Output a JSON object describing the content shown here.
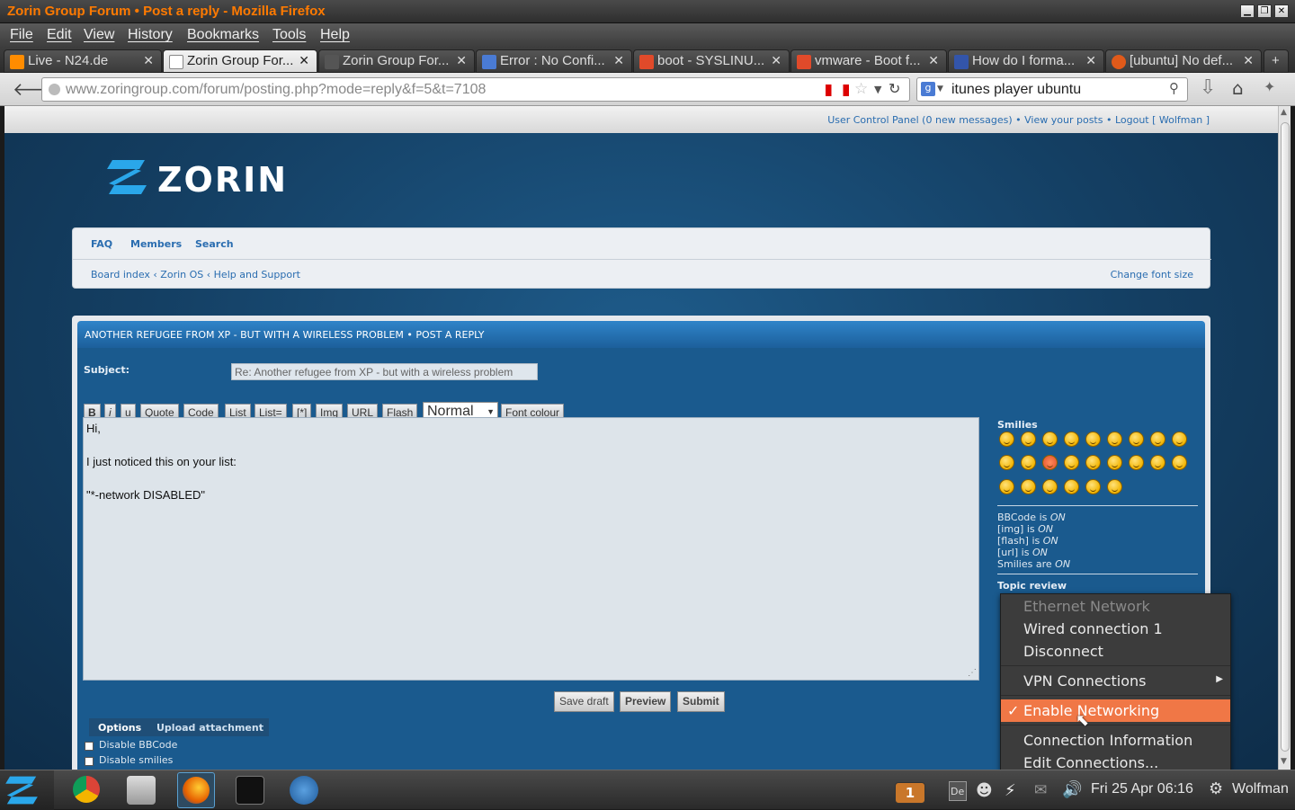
{
  "window": {
    "title": "Zorin Group Forum • Post a reply - Mozilla Firefox"
  },
  "menu": [
    "File",
    "Edit",
    "View",
    "History",
    "Bookmarks",
    "Tools",
    "Help"
  ],
  "tabs": [
    {
      "label": "Live - N24.de",
      "color": "#ff8c00"
    },
    {
      "label": "Zorin Group For...",
      "color": "#ffffff",
      "active": true
    },
    {
      "label": "Zorin Group For...",
      "color": "#555555"
    },
    {
      "label": "Error : No Confi...",
      "color": "#4a7bd4"
    },
    {
      "label": "boot - SYSLINU...",
      "color": "#e04a2a"
    },
    {
      "label": "vmware - Boot f...",
      "color": "#e04a2a"
    },
    {
      "label": "How do I forma...",
      "color": "#3355aa"
    },
    {
      "label": "[ubuntu] No def...",
      "color": "#e05a1a"
    }
  ],
  "nav": {
    "url": "www.zoringroup.com/forum/posting.php?mode=reply&f=5&t=7108",
    "search": "itunes player ubuntu"
  },
  "forum": {
    "userbar": "User Control Panel (0 new messages) • View your posts • Logout [ Wolfman ]",
    "logo": "ZORIN",
    "links": {
      "faq": "FAQ",
      "members": "Members",
      "search": "Search"
    },
    "breadcrumb": "Board index ‹ Zorin OS ‹ Help and Support",
    "change_font": "Change font size",
    "post_title": "ANOTHER REFUGEE FROM XP - BUT WITH A WIRELESS PROBLEM • POST A REPLY",
    "subject_label": "Subject:",
    "subject_value": "Re: Another refugee from XP - but with a wireless problem",
    "bbcode": [
      "B",
      "i",
      "u",
      "Quote",
      "Code",
      "List",
      "List=",
      "[*]",
      "Img",
      "URL",
      "Flash"
    ],
    "font_size": "Normal",
    "font_colour": "Font colour",
    "message": [
      "Hi,",
      "I just noticed this on your list:",
      "\"*-network DISABLED\""
    ],
    "smilies_label": "Smilies",
    "status": [
      {
        "name": "BBCode",
        "verb": "is",
        "val": "ON"
      },
      {
        "name": "[img]",
        "verb": "is",
        "val": "ON"
      },
      {
        "name": "[flash]",
        "verb": "is",
        "val": "ON"
      },
      {
        "name": "[url]",
        "verb": "is",
        "val": "ON"
      },
      {
        "name": "Smilies",
        "verb": "are",
        "val": "ON"
      }
    ],
    "topic_review": "Topic review",
    "buttons": {
      "save": "Save draft",
      "preview": "Preview",
      "submit": "Submit"
    },
    "options_tab": "Options",
    "upload_tab": "Upload attachment",
    "disable_bbcode": "Disable BBCode",
    "disable_smilies": "Disable smilies"
  },
  "network_menu": {
    "items": [
      "Ethernet Network",
      "Wired connection 1",
      "Disconnect",
      "VPN Connections",
      "Enable Networking",
      "Connection Information",
      "Edit Connections..."
    ]
  },
  "taskbar": {
    "workspace": "1",
    "keyboard": "De",
    "clock": "Fri 25 Apr 06:16",
    "user": "Wolfman"
  }
}
